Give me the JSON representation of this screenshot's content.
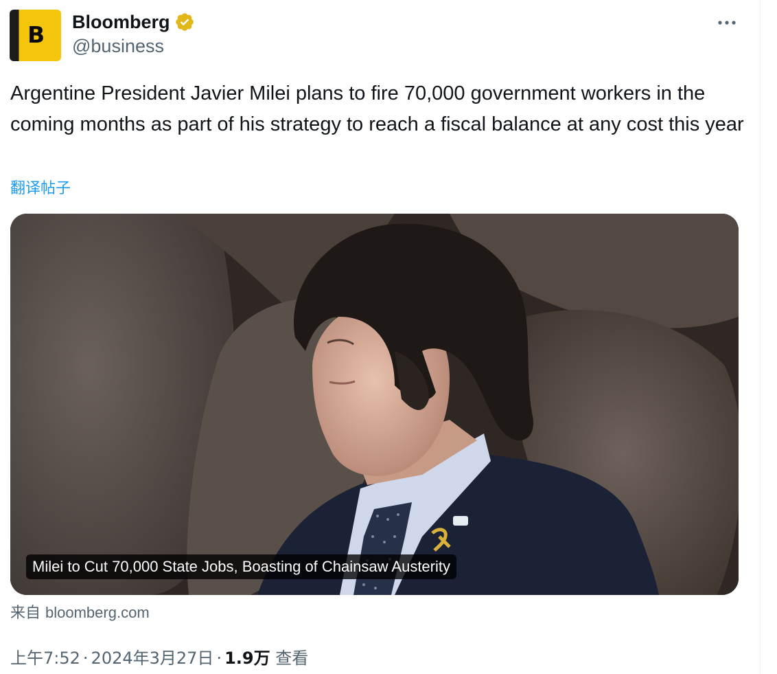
{
  "author": {
    "display_name": "Bloomberg",
    "handle": "@business",
    "avatar_letter": "B",
    "verified": true
  },
  "menu": {
    "icon": "more-horizontal-icon"
  },
  "tweet": {
    "text": "Argentine President Javier Milei plans to fire 70,000 government workers in the coming months as part of his strategy to reach a fiscal balance at any cost this year",
    "translate_label": "翻译帖子"
  },
  "link_card": {
    "caption": "Milei to Cut 70,000 State Jobs, Boasting of Chainsaw Austerity",
    "source_prefix": "来自",
    "source_domain": "bloomberg.com"
  },
  "meta": {
    "time": "上午7:52",
    "separator": "·",
    "date": "2024年3月27日",
    "views_count": "1.9万",
    "views_label": "查看"
  },
  "colors": {
    "accent": "#1d9bf0",
    "secondary_text": "#536471",
    "primary_text": "#0f1419",
    "verified_badge": "#e2b719"
  }
}
